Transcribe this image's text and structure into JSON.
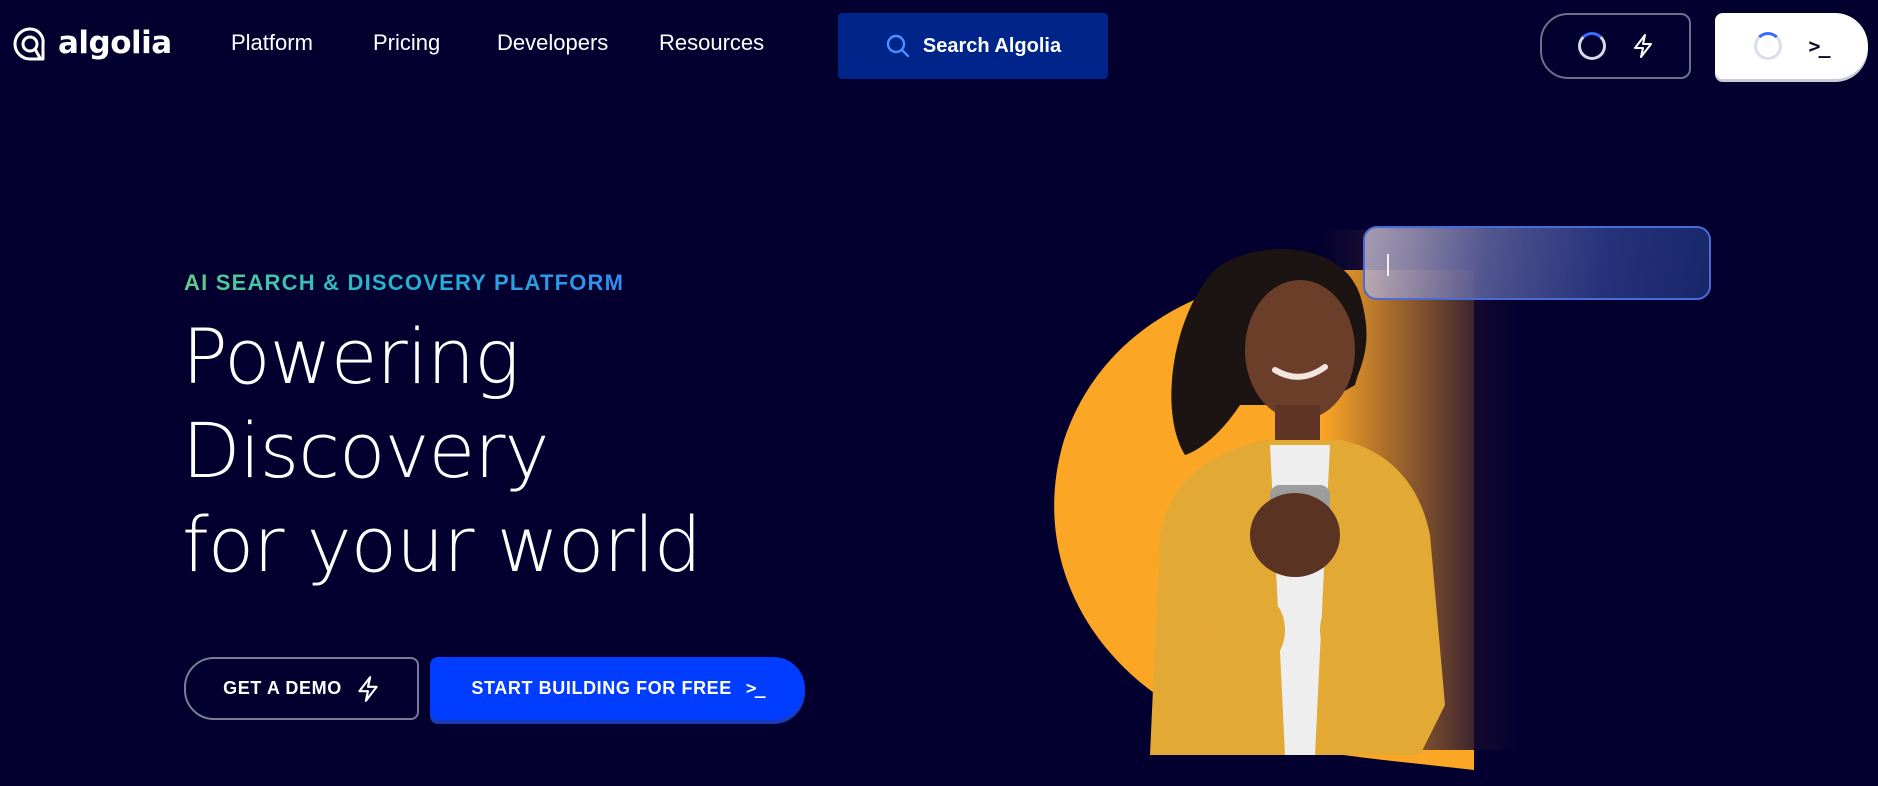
{
  "brand": {
    "name": "algolia",
    "logo_icon": "algolia-mark-icon"
  },
  "nav": {
    "links": [
      {
        "label": "Platform"
      },
      {
        "label": "Pricing"
      },
      {
        "label": "Developers"
      },
      {
        "label": "Resources"
      }
    ],
    "search": {
      "label": "Search Algolia",
      "icon": "search-icon"
    },
    "demo_button": {
      "icons": [
        "loading-spinner-icon",
        "lightning-bolt-icon"
      ]
    },
    "build_button": {
      "icons": [
        "loading-spinner-icon",
        "terminal-prompt-icon"
      ]
    }
  },
  "hero": {
    "eyebrow": "AI SEARCH & DISCOVERY PLATFORM",
    "headline_lines": [
      "Powering",
      "Discovery",
      "for your world"
    ],
    "cta_demo": {
      "label": "GET A DEMO",
      "icon": "lightning-bolt-icon"
    },
    "cta_build": {
      "label": "START BUILDING FOR FREE",
      "icon": "terminal-prompt-icon",
      "glyph": ">_"
    },
    "visual": {
      "image_subject": "smiling woman in yellow cardigan holding a mug",
      "search_input_value": ""
    }
  },
  "colors": {
    "background": "#03002f",
    "search_button_bg": "#00258a",
    "primary_button_bg": "#003dff",
    "accent_orange": "#fca625",
    "eyebrow_gradient": [
      "#5ccf88",
      "#22b6cf",
      "#2f8df0"
    ]
  }
}
